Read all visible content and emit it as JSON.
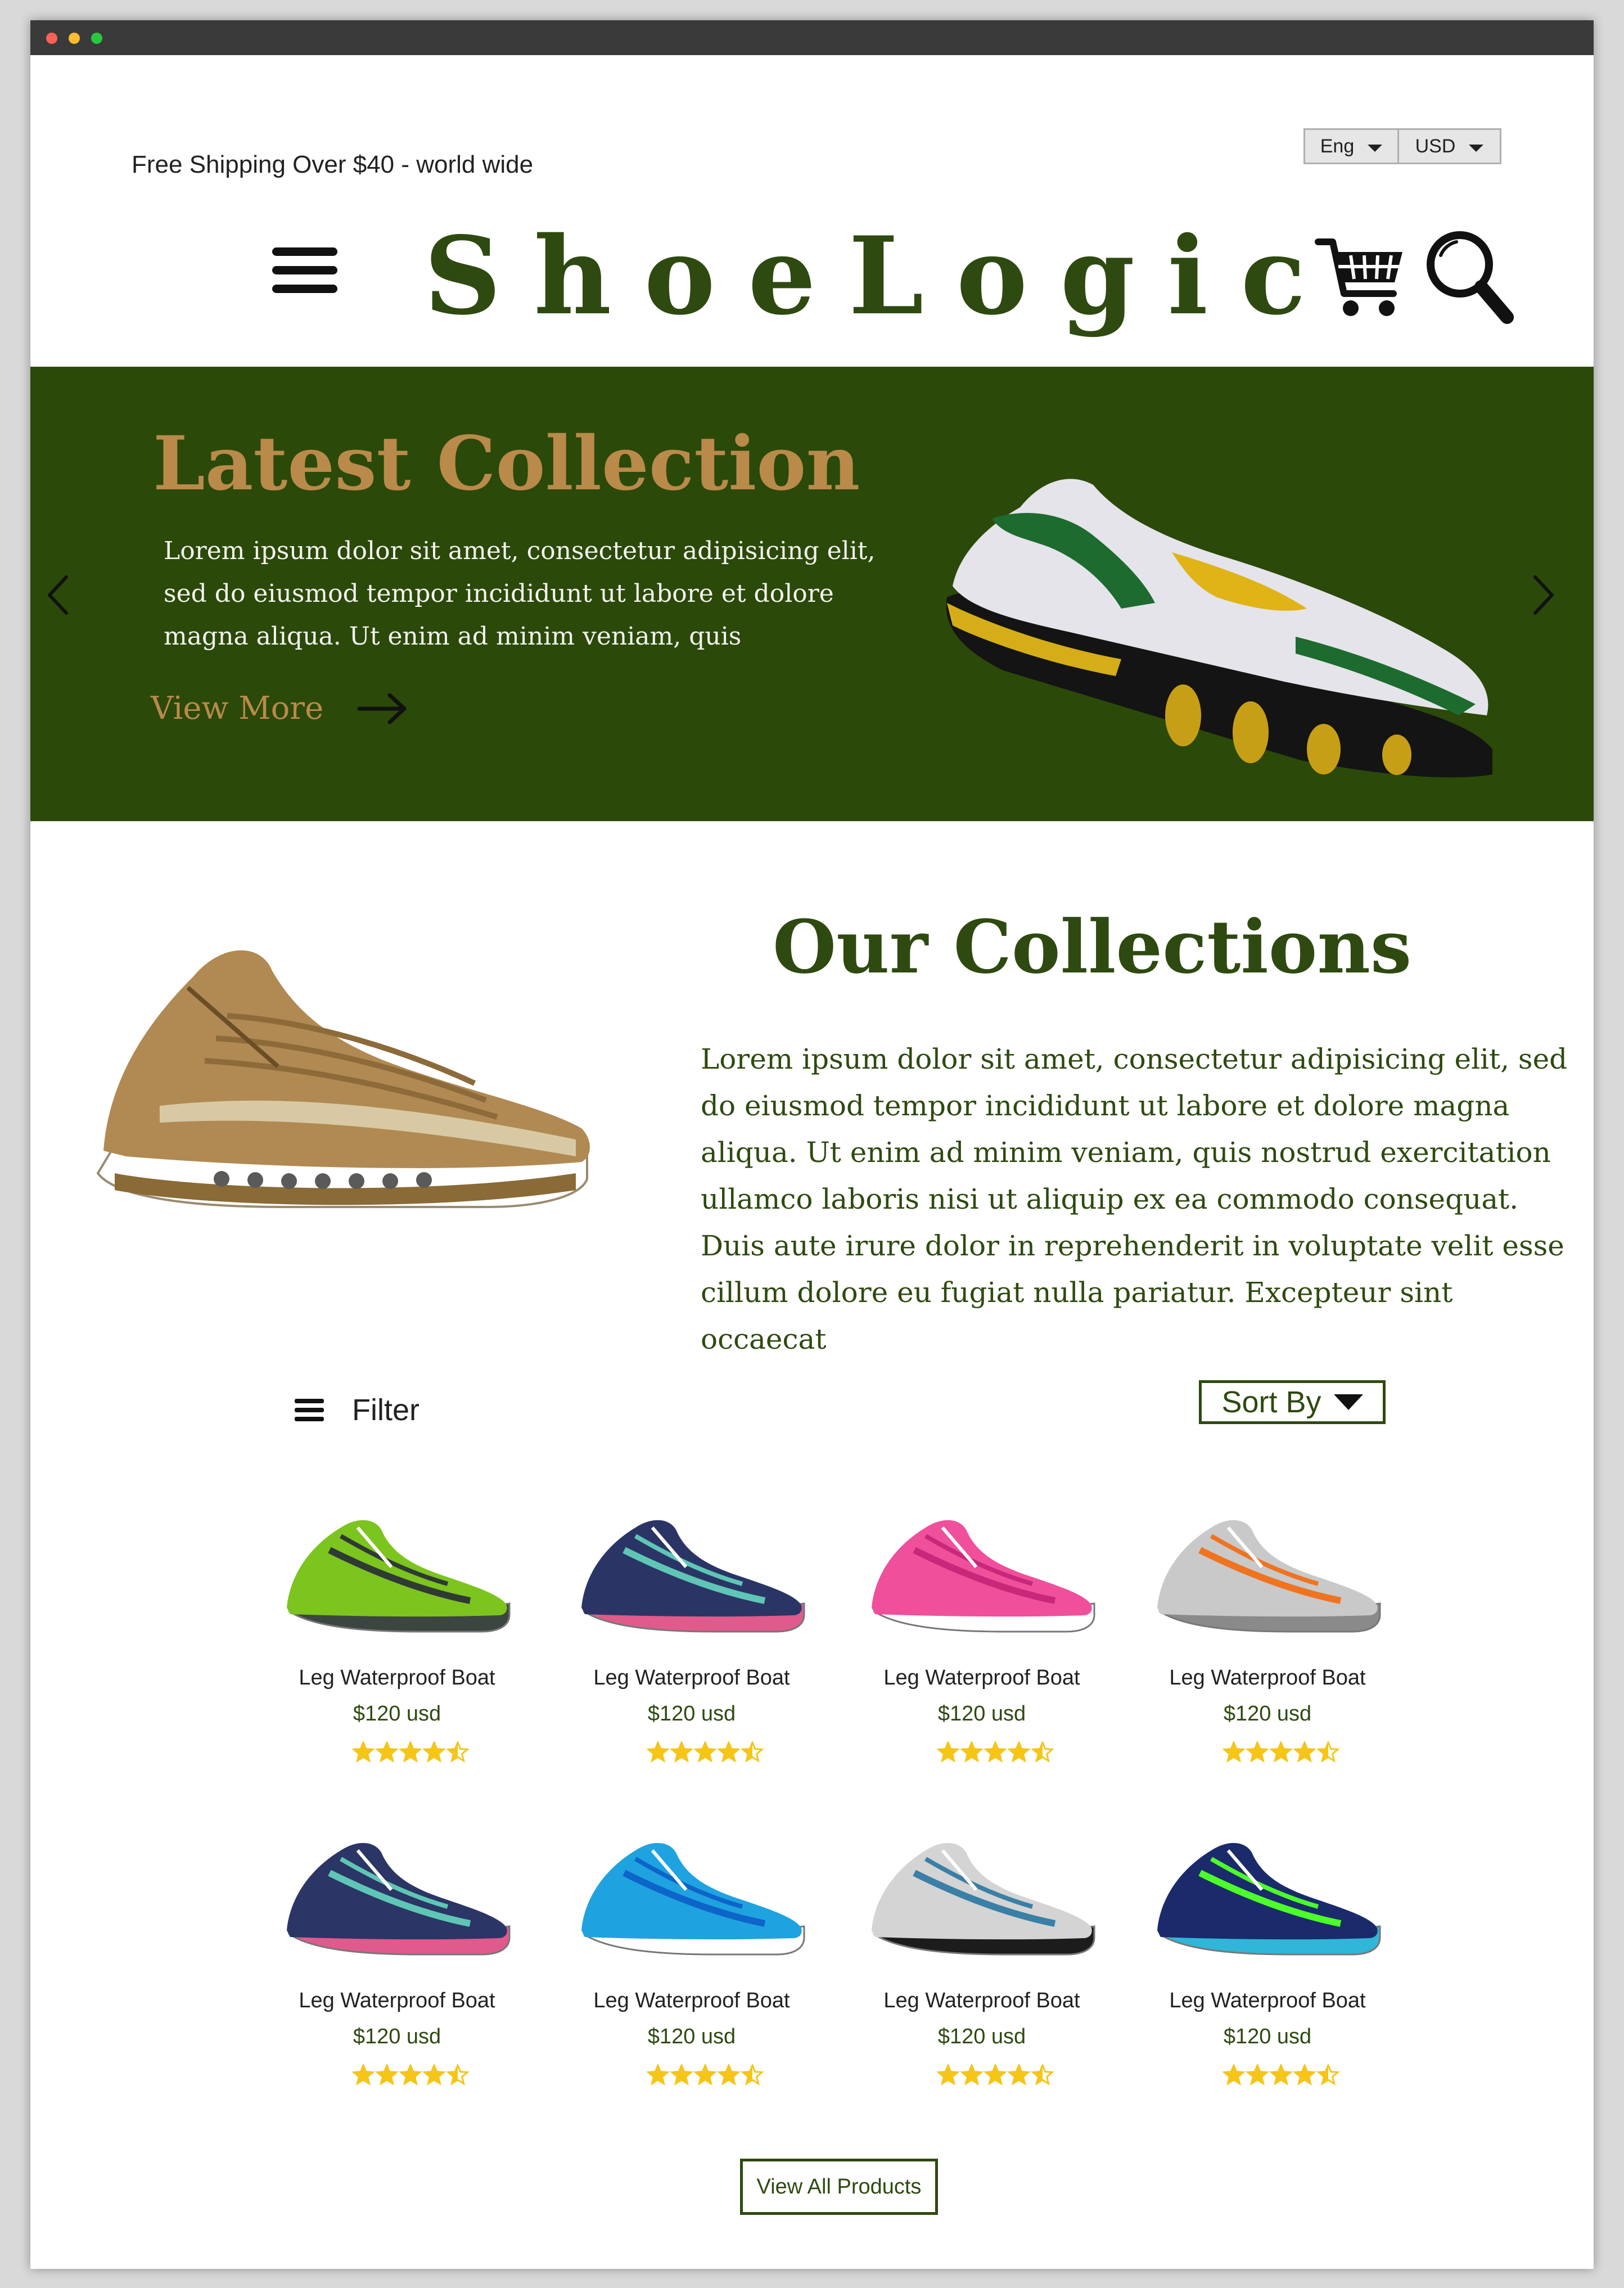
{
  "header": {
    "shipping_text": "Free Shipping Over $40 - world wide",
    "language_selected": "Eng",
    "currency_selected": "USD",
    "logo": "ShoeLogic",
    "icons": [
      "menu-icon",
      "cart-icon",
      "search-icon"
    ]
  },
  "hero": {
    "title": "Latest Collection",
    "text": "Lorem ipsum dolor sit amet, consectetur adipisicing elit, sed do eiusmod tempor incididunt ut labore et dolore magna aliqua. Ut enim ad minim veniam, quis",
    "cta": "View More"
  },
  "collections": {
    "title": "Our Collections",
    "text": "Lorem ipsum dolor sit amet, consectetur adipisicing elit, sed do eiusmod tempor incididunt ut labore et dolore magna aliqua. Ut enim ad minim veniam, quis nostrud exercitation ullamco laboris nisi ut aliquip ex ea commodo consequat. Duis aute irure dolor in reprehenderit in voluptate velit esse cillum dolore eu fugiat nulla pariatur. Excepteur sint occaecat"
  },
  "toolbar": {
    "filter_label": "Filter",
    "sort_label": "Sort By"
  },
  "products": [
    {
      "name": "Leg Waterproof Boat",
      "price": "$120 usd",
      "rating": 4.5,
      "palette": {
        "upper": "#7cc41e",
        "accent": "#2f3a34",
        "sole": "#3c4640"
      }
    },
    {
      "name": "Leg Waterproof Boat",
      "price": "$120 usd",
      "rating": 4.5,
      "palette": {
        "upper": "#2a3566",
        "accent": "#5fc6b5",
        "sole": "#e05a8c"
      }
    },
    {
      "name": "Leg Waterproof Boat",
      "price": "$120 usd",
      "rating": 4.5,
      "palette": {
        "upper": "#f04f9b",
        "accent": "#c7287a",
        "sole": "#ffffff"
      }
    },
    {
      "name": "Leg Waterproof Boat",
      "price": "$120 usd",
      "rating": 4.5,
      "palette": {
        "upper": "#c9c9c9",
        "accent": "#f0731f",
        "sole": "#8a8a8a"
      }
    },
    {
      "name": "Leg Waterproof Boat",
      "price": "$120 usd",
      "rating": 4.5,
      "palette": {
        "upper": "#2b3566",
        "accent": "#5fc6b5",
        "sole": "#e05a8c"
      }
    },
    {
      "name": "Leg Waterproof Boat",
      "price": "$120 usd",
      "rating": 4.5,
      "palette": {
        "upper": "#1fa3e0",
        "accent": "#0d64c9",
        "sole": "#ffffff"
      }
    },
    {
      "name": "Leg Waterproof Boat",
      "price": "$120 usd",
      "rating": 4.5,
      "palette": {
        "upper": "#d4d4d4",
        "accent": "#3a7fa6",
        "sole": "#1c1c1c"
      }
    },
    {
      "name": "Leg Waterproof Boat",
      "price": "$120 usd",
      "rating": 4.5,
      "palette": {
        "upper": "#1a2a6b",
        "accent": "#4cff2a",
        "sole": "#2fb6d8"
      }
    }
  ],
  "footer": {
    "view_all_label": "View All Products"
  },
  "colors": {
    "brand_green": "#2e4a10",
    "hero_background": "#2b4909",
    "hero_accent": "#b98a49",
    "star": "#f5c518"
  }
}
